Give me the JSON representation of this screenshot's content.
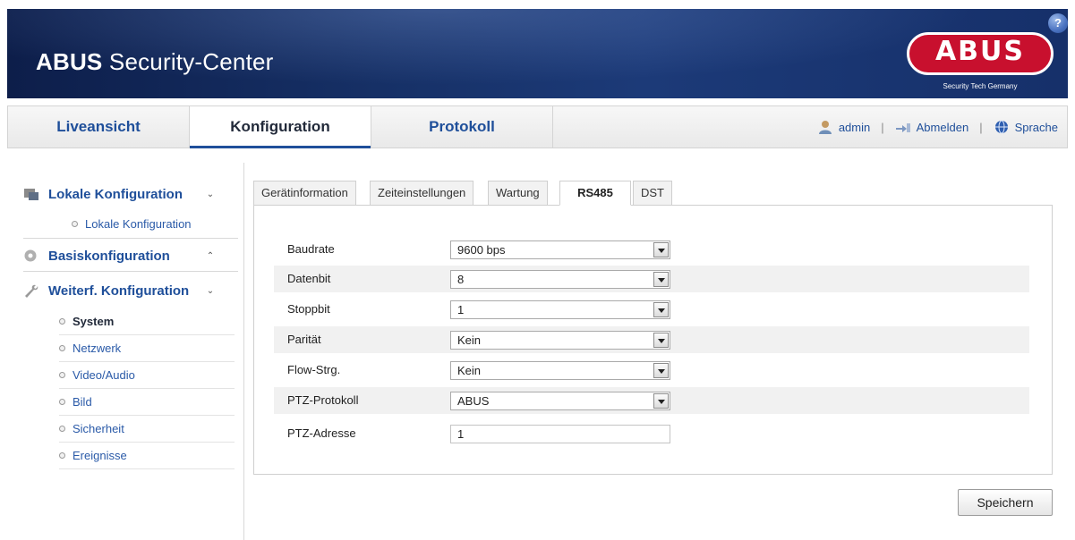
{
  "header": {
    "title_bold": "ABUS",
    "title_rest": " Security-Center",
    "logo_text": "ABUS",
    "logo_tagline": "Security Tech Germany",
    "help": "?"
  },
  "nav": {
    "tabs": [
      {
        "label": "Liveansicht"
      },
      {
        "label": "Konfiguration"
      },
      {
        "label": "Protokoll"
      }
    ],
    "active_tab": "Konfiguration",
    "user": "admin",
    "logout": "Abmelden",
    "language": "Sprache",
    "separator": "|"
  },
  "sidebar": {
    "groups": [
      {
        "label": "Lokale Konfiguration",
        "icon": "local-config-icon",
        "chevron": "⌄"
      },
      {
        "label": "Basiskonfiguration",
        "icon": "base-config-icon",
        "chevron": "⌃"
      },
      {
        "label": "Weiterf. Konfiguration",
        "icon": "wrench-icon",
        "chevron": "⌄"
      }
    ],
    "local_items": [
      "Lokale Konfiguration"
    ],
    "advanced_items": [
      "System",
      "Netzwerk",
      "Video/Audio",
      "Bild",
      "Sicherheit",
      "Ereignisse"
    ],
    "active_item": "System"
  },
  "content": {
    "tabs": [
      "Gerätinformation",
      "Zeiteinstellungen",
      "Wartung",
      "RS485",
      "DST"
    ],
    "active_tab": "RS485",
    "fields": [
      {
        "label": "Baudrate",
        "value": "9600 bps",
        "type": "select"
      },
      {
        "label": "Datenbit",
        "value": "8",
        "type": "select"
      },
      {
        "label": "Stoppbit",
        "value": "1",
        "type": "select"
      },
      {
        "label": "Parität",
        "value": "Kein",
        "type": "select"
      },
      {
        "label": "Flow-Strg.",
        "value": "Kein",
        "type": "select"
      },
      {
        "label": "PTZ-Protokoll",
        "value": "ABUS",
        "type": "select"
      },
      {
        "label": "PTZ-Adresse",
        "value": "1",
        "type": "text"
      }
    ],
    "save_label": "Speichern"
  },
  "colors": {
    "header_bg": "#163066",
    "link_blue": "#1f4f9a",
    "logo_red": "#c8102e"
  }
}
